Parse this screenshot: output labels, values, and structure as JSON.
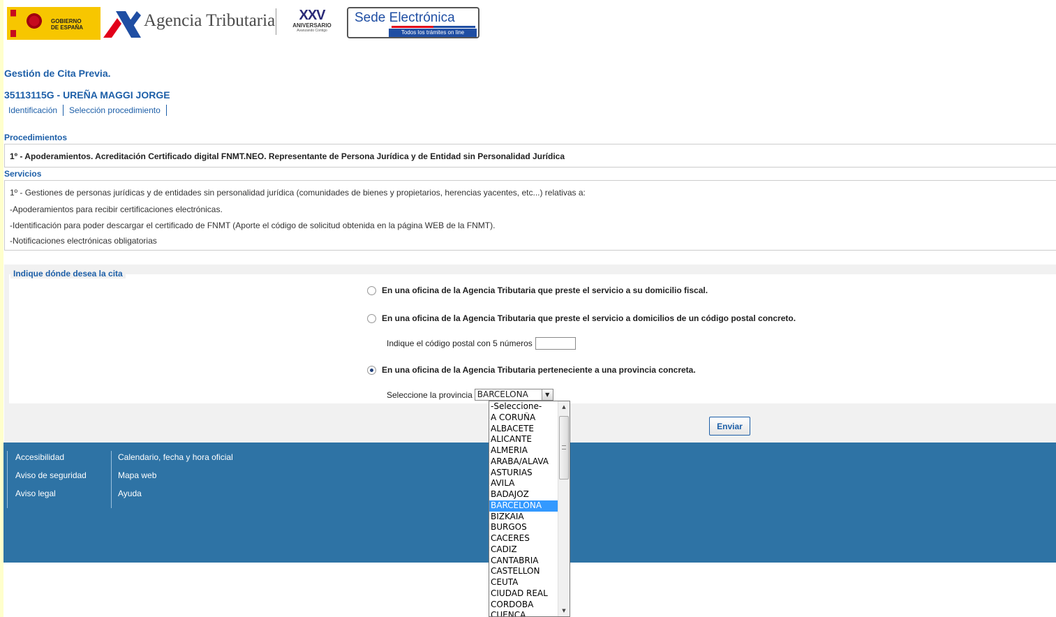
{
  "header": {
    "gob_logo_text_1": "GOBIERNO",
    "gob_logo_text_2": "DE ESPAÑA",
    "agency_name": "Agencia Tributaria",
    "anniversary_big": "XXV",
    "anniversary_word": "ANIVERSARIO",
    "anniversary_tagline": "Avanzando Contigo",
    "sede_title": "Sede Electrónica",
    "sede_subtitle": "Todos los trámites on line"
  },
  "page": {
    "title": "Gestión de Cita Previa.",
    "user": "35113115G - UREÑA MAGGI JORGE"
  },
  "breadcrumb": [
    "Identificación",
    "Selección procedimiento"
  ],
  "procedimientos": {
    "label": "Procedimientos",
    "text": "1º - Apoderamientos. Acreditación Certificado digital FNMT.NEO. Representante de Persona Jurídica y de Entidad sin Personalidad Jurídica"
  },
  "servicios": {
    "label": "Servicios",
    "lines": [
      "1º - Gestiones de personas jurídicas y de entidades sin personalidad jurídica (comunidades de bienes y propietarios, herencias yacentes, etc...) relativas a:",
      "-Apoderamientos para recibir certificaciones electrónicas.",
      "-Identificación para poder descargar el certificado de FNMT (Aporte el código de solicitud obtenida en la página WEB de la FNMT).",
      "-Notificaciones electrónicas obligatorias"
    ]
  },
  "cita": {
    "legend": "Indique dónde desea la cita",
    "options": [
      "En una oficina de la Agencia Tributaria que preste el servicio a su domicilio fiscal.",
      "En una oficina de la Agencia Tributaria que preste el servicio a domicilios de un código postal concreto.",
      "En una oficina de la Agencia Tributaria perteneciente a una provincia concreta."
    ],
    "selected_option": 2,
    "postal_label": "Indique el código postal con 5 números",
    "postal_value": "",
    "province_label": "Seleccione la provincia",
    "province_value": "BARCELONA",
    "submit_label": "Enviar"
  },
  "province_options": [
    "-Seleccione-",
    "A CORUÑA",
    "ALBACETE",
    "ALICANTE",
    "ALMERIA",
    "ARABA/ALAVA",
    "ASTURIAS",
    "AVILA",
    "BADAJOZ",
    "BARCELONA",
    "BIZKAIA",
    "BURGOS",
    "CACERES",
    "CADIZ",
    "CANTABRIA",
    "CASTELLON",
    "CEUTA",
    "CIUDAD REAL",
    "CORDOBA",
    "CUENCA"
  ],
  "province_selected_index": 9,
  "footer": {
    "col1": [
      "Accesibilidad",
      "Aviso de seguridad",
      "Aviso legal"
    ],
    "col2": [
      "Calendario, fecha y hora oficial",
      "Mapa web",
      "Ayuda"
    ]
  },
  "colors": {
    "brand_blue": "#1d5fa8",
    "footer_bg": "#2e73a5",
    "page_margin": "#ffffcc",
    "selection": "#3399ff"
  }
}
